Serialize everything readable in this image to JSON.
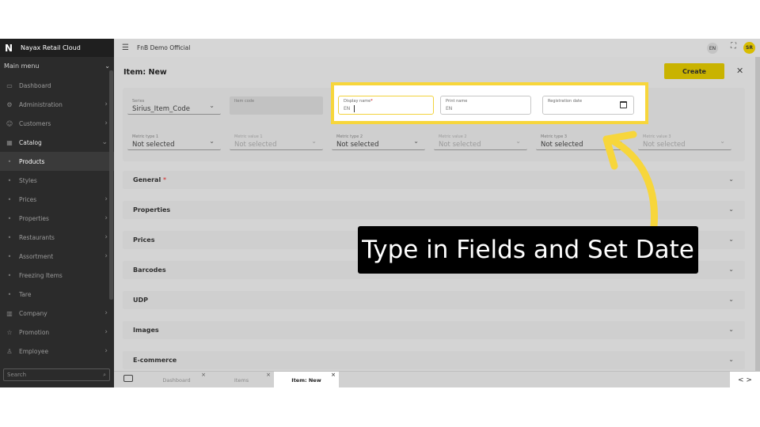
{
  "sidebar": {
    "brand_logo": "N",
    "brand_name": "Nayax Retail Cloud",
    "main_menu": "Main menu",
    "search_placeholder": "Search",
    "items": [
      {
        "label": "Dashboard",
        "icon": "dashboard-icon"
      },
      {
        "label": "Administration",
        "icon": "gear-icon"
      },
      {
        "label": "Customers",
        "icon": "users-icon"
      },
      {
        "label": "Catalog",
        "icon": "catalog-icon"
      },
      {
        "label": "Products"
      },
      {
        "label": "Styles"
      },
      {
        "label": "Prices"
      },
      {
        "label": "Properties"
      },
      {
        "label": "Restaurants"
      },
      {
        "label": "Assortment"
      },
      {
        "label": "Freezing Items"
      },
      {
        "label": "Tare"
      },
      {
        "label": "Company",
        "icon": "building-icon"
      },
      {
        "label": "Promotion",
        "icon": "star-icon"
      },
      {
        "label": "Employee",
        "icon": "employee-icon"
      }
    ]
  },
  "topbar": {
    "org": "FnB Demo Official",
    "lang": "EN",
    "avatar": "SR"
  },
  "page": {
    "title": "Item: New",
    "create_label": "Create",
    "close_label": "✕"
  },
  "form": {
    "series": {
      "label": "Series",
      "value": "Sirius_Item_Code"
    },
    "item_code": {
      "label": "Item code"
    },
    "display_name": {
      "label": "Display name",
      "required_mark": "*",
      "lang": "EN"
    },
    "print_name": {
      "label": "Print name",
      "lang": "EN"
    },
    "registration_date": {
      "label": "Registration date"
    },
    "metrics": [
      {
        "label": "Metric type 1",
        "value": "Not selected"
      },
      {
        "label": "Metric value 1",
        "value": "Not selected"
      },
      {
        "label": "Metric type 2",
        "value": "Not selected"
      },
      {
        "label": "Metric value 2",
        "value": "Not selected"
      },
      {
        "label": "Metric type 3",
        "value": "Not selected"
      },
      {
        "label": "Metric value 3",
        "value": "Not selected"
      }
    ]
  },
  "sections": [
    {
      "title": "General",
      "required": "*"
    },
    {
      "title": "Properties"
    },
    {
      "title": "Prices"
    },
    {
      "title": "Barcodes"
    },
    {
      "title": "UDP"
    },
    {
      "title": "Images"
    },
    {
      "title": "E-commerce"
    }
  ],
  "tabs": [
    {
      "label": "Dashboard"
    },
    {
      "label": "Items"
    },
    {
      "label": "Item: New"
    }
  ],
  "tab_nav": "< >",
  "annotation": {
    "text": "Type in Fields and Set Date",
    "highlight_color": "#f7d63b"
  },
  "colors": {
    "accent": "#c9b300",
    "sidebar_bg": "#2b2b2b",
    "content_bg": "#d4d4d4"
  }
}
